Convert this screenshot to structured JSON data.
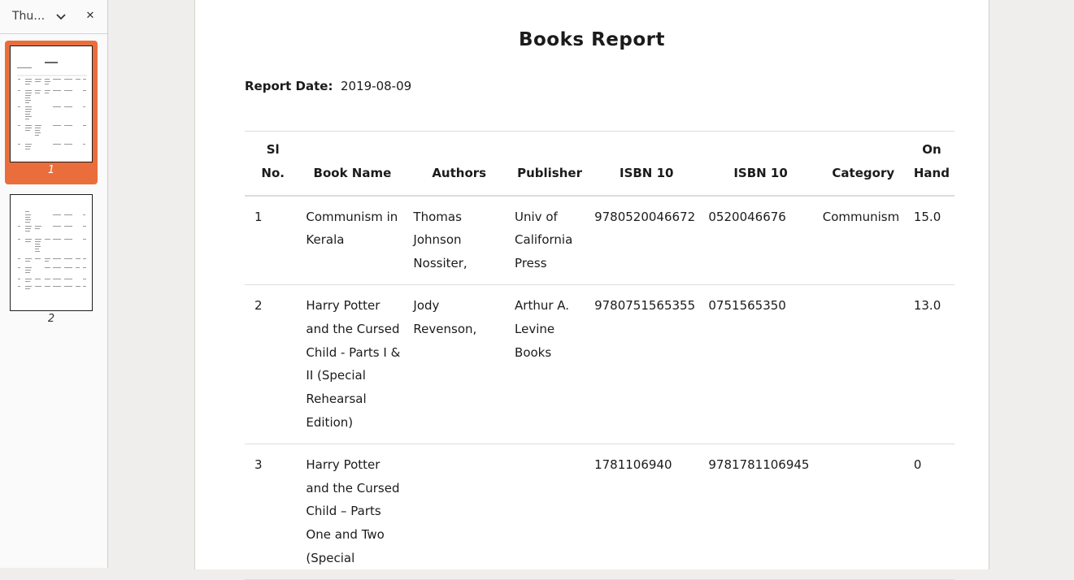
{
  "sidebar": {
    "title": "Thu…",
    "thumbnails": [
      {
        "page_label": "1",
        "selected": true
      },
      {
        "page_label": "2",
        "selected": false
      }
    ]
  },
  "document": {
    "title": "Books Report",
    "report_date_label": "Report Date:",
    "report_date_value": "2019-08-09",
    "table": {
      "headers": [
        "Sl No.",
        "Book Name",
        "Authors",
        "Publisher",
        "ISBN 10",
        "ISBN 10",
        "Category",
        "On Hand"
      ],
      "rows": [
        [
          "1",
          "Communism in Kerala",
          "Thomas Johnson Nossiter,",
          "Univ of California Press",
          "9780520046672",
          "0520046676",
          "Communism",
          "15.0"
        ],
        [
          "2",
          "Harry Potter and the Cursed Child - Parts I & II (Special Rehearsal Edition)",
          "Jody Revenson,",
          "Arthur A. Levine Books",
          "9780751565355",
          "0751565350",
          "",
          "13.0"
        ],
        [
          "3",
          "Harry Potter and the Cursed Child – Parts One and Two (Special",
          "",
          "",
          "1781106940",
          "9781781106945",
          "",
          "0"
        ]
      ]
    }
  },
  "colors": {
    "selection_accent": "#ea6e3b",
    "app_background": "#efeeed",
    "sidebar_background": "#fafafa"
  }
}
